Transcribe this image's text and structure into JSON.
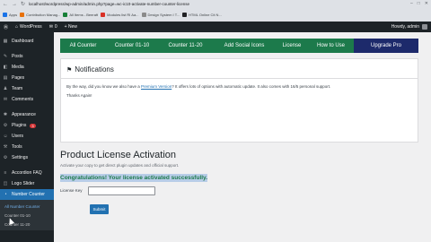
{
  "browser": {
    "url": "localhost/wordpress/wp-admin/admin.php?page=wc-ic10-activate-number-counter-license",
    "bookmarks": [
      "Apps",
      "Contribution Manag...",
      "All Items - Beeraft",
      "Modules list RI Aa...",
      "Design System I T...",
      "HTML Online Cit N..."
    ]
  },
  "adminbar": {
    "site": "WordPress",
    "comments": "0",
    "new_label": "+ New",
    "howdy": "Howdy, admin"
  },
  "sidebar": {
    "items": [
      {
        "icon": "dashboard-icon",
        "glyph": "▦",
        "label": "Dashboard"
      },
      {
        "icon": "posts-icon",
        "glyph": "✎",
        "label": "Posts"
      },
      {
        "icon": "media-icon",
        "glyph": "◧",
        "label": "Media"
      },
      {
        "icon": "pages-icon",
        "glyph": "▤",
        "label": "Pages"
      },
      {
        "icon": "team-icon",
        "glyph": "♟",
        "label": "Team"
      },
      {
        "icon": "comments-icon",
        "glyph": "✉",
        "label": "Comments"
      },
      {
        "icon": "appearance-icon",
        "glyph": "✱",
        "label": "Appearance"
      },
      {
        "icon": "plugins-icon",
        "glyph": "⚙",
        "label": "Plugins"
      },
      {
        "icon": "users-icon",
        "glyph": "☺",
        "label": "Users"
      },
      {
        "icon": "tools-icon",
        "glyph": "⚒",
        "label": "Tools"
      },
      {
        "icon": "settings-icon",
        "glyph": "⚙",
        "label": "Settings"
      },
      {
        "icon": "accordion-icon",
        "glyph": "≡",
        "label": "Accordion FAQ"
      },
      {
        "icon": "slider-icon",
        "glyph": "◫",
        "label": "Logo Slider"
      },
      {
        "icon": "counter-icon",
        "glyph": "◔",
        "label": "Number Counter"
      }
    ],
    "plugins_badge": "3",
    "submenu": [
      "All Number Counter",
      "Counter 01-10",
      "Counter 11-20"
    ]
  },
  "tabs": [
    "All Counter",
    "Counter 01-10",
    "Counter 11-20",
    "Add Social Icons",
    "License",
    "How to Use",
    "Upgrade Pro"
  ],
  "notice": {
    "title": "Notifications",
    "text_before": "By the way, did you know we also have a ",
    "link": "Premium Version",
    "text_after": "? It offers lots of options with automatic update. It also comes with 16/5 personal support.",
    "thanks": "Thanks Again!"
  },
  "activation": {
    "title": "Product License Activation",
    "subtitle": "Activate your copy to get direct plugin updates and official support.",
    "success": "Congratulations! Your license activated successfully.",
    "license_label": "License Key",
    "license_value": "",
    "submit": "Submit"
  },
  "colors": {
    "tab_bar": "#1c7a4b",
    "upgrade": "#1d2a6b",
    "wp_dark": "#1d2327",
    "wp_blue": "#2271b1"
  }
}
